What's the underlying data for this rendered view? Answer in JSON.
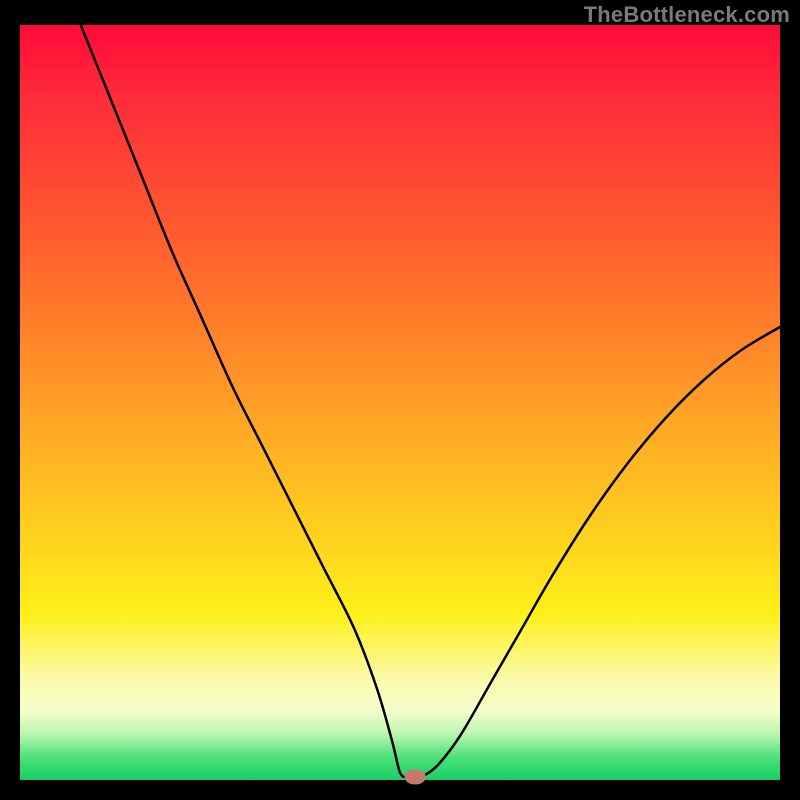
{
  "watermark": "TheBottleneck.com",
  "colors": {
    "curve": "#000000",
    "marker": "#c9796b",
    "gradient_top": "#ff0a3a",
    "gradient_bottom": "#18cf66"
  },
  "chart_data": {
    "type": "line",
    "title": "",
    "xlabel": "",
    "ylabel": "",
    "xlim": [
      0,
      100
    ],
    "ylim": [
      0,
      100
    ],
    "series": [
      {
        "name": "bottleneck-curve",
        "x": [
          8,
          12,
          16,
          20,
          24,
          28,
          32,
          36,
          40,
          44,
          47,
          49,
          50,
          51,
          52,
          53,
          55,
          58,
          62,
          66,
          70,
          75,
          80,
          85,
          90,
          95,
          100
        ],
        "y": [
          100,
          90,
          80,
          70,
          61,
          52,
          44,
          36,
          28,
          20,
          12,
          5,
          1,
          0.3,
          0.3,
          0.5,
          2,
          6,
          13,
          20,
          27,
          35,
          42,
          48,
          53,
          57,
          60
        ]
      }
    ],
    "marker": {
      "x": 52,
      "y": 0.4,
      "rx": 1.4,
      "ry": 1.0
    },
    "curve_stroke_width": 2.5
  }
}
